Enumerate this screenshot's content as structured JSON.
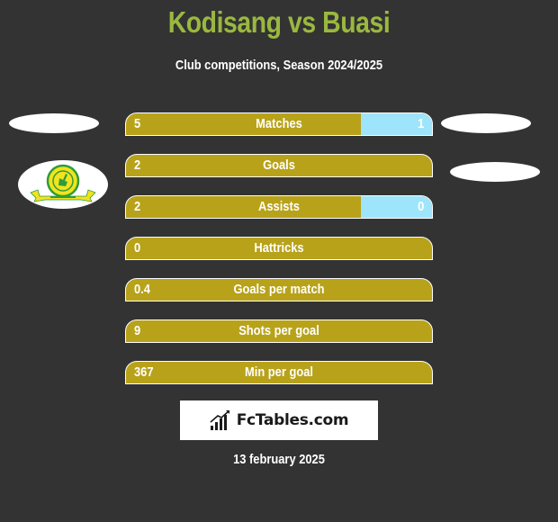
{
  "header": {
    "title": "Kodisang vs Buasi",
    "subtitle": "Club competitions, Season 2024/2025"
  },
  "colors": {
    "title": "#9ab83f",
    "left_bar": "#b8a21a",
    "right_bar": "#9ee5fb",
    "background": "#333333"
  },
  "players": {
    "left": {
      "name": "Kodisang",
      "club_logo": "mamelodi-sundowns-logo"
    },
    "right": {
      "name": "Buasi"
    }
  },
  "stats": [
    {
      "label": "Matches",
      "left": "5",
      "right": "1",
      "right_share": 0.2333
    },
    {
      "label": "Goals",
      "left": "2",
      "right": "",
      "right_share": 0
    },
    {
      "label": "Assists",
      "left": "2",
      "right": "0",
      "right_share": 0.2333
    },
    {
      "label": "Hattricks",
      "left": "0",
      "right": "",
      "right_share": 0
    },
    {
      "label": "Goals per match",
      "left": "0.4",
      "right": "",
      "right_share": 0
    },
    {
      "label": "Shots per goal",
      "left": "9",
      "right": "",
      "right_share": 0
    },
    {
      "label": "Min per goal",
      "left": "367",
      "right": "",
      "right_share": 0
    }
  ],
  "footer": {
    "brand": "FcTables.com",
    "date": "13 february 2025"
  }
}
